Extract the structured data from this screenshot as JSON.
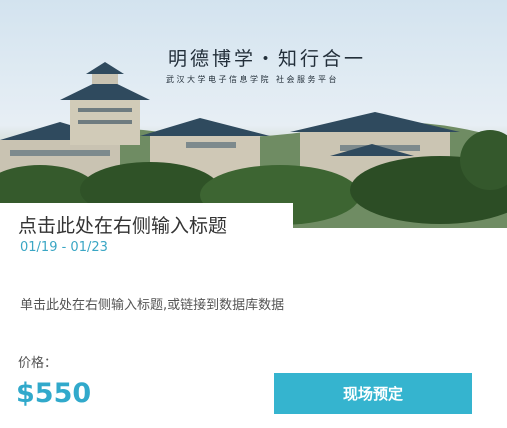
{
  "banner": {
    "slogan": "明德博学・知行合一",
    "subtitle": "武汉大学电子信息学院 社会服务平台",
    "image_subject": "campus-buildings-photo"
  },
  "card": {
    "title": "点击此处在右侧输入标题",
    "date_range": "01/19 - 01/23",
    "description": "单击此处在右侧输入标题,或链接到数据库数据",
    "price_label": "价格：",
    "price": "$550",
    "book_button_label": "现场预定"
  },
  "colors": {
    "accent": "#31a9cb",
    "button_bg": "#35b4cf",
    "roof": "#2f4a5e"
  }
}
